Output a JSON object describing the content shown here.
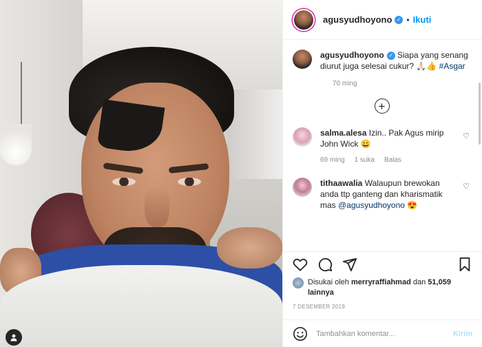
{
  "header": {
    "username": "agusyudhoyono",
    "separator": "•",
    "follow_label": "Ikuti"
  },
  "caption": {
    "username": "agusyudhoyono",
    "text": "Siapa yang senang diurut juga selesai cukur? 🙏🏻👍",
    "hashtag": "#Asgar",
    "time": "70 ming"
  },
  "load_more_icon": "plus-circle-icon",
  "comments": [
    {
      "username": "salma.alesa",
      "text": "Izin.. Pak Agus mirip John Wick 😀",
      "time": "69 ming",
      "likes": "1 suka",
      "reply": "Balas"
    },
    {
      "username": "tithaawalia",
      "text": "Walaupun brewokan anda ttp ganteng dan kharismatik mas",
      "mention": "@agusyudhoyono",
      "emoji": "😍"
    }
  ],
  "likes": {
    "prefix": "Disukai oleh",
    "user": "merryraffiahmad",
    "suffix": "dan",
    "count": "51,059 lainnya"
  },
  "date": "7 DESEMBER 2019",
  "comment_box": {
    "placeholder": "Tambahkan komentar...",
    "post_label": "Kirim"
  },
  "colors": {
    "accent": "#0095f6",
    "verified": "#3897f0",
    "hashtag": "#00376b",
    "muted": "#8e8e8e"
  }
}
